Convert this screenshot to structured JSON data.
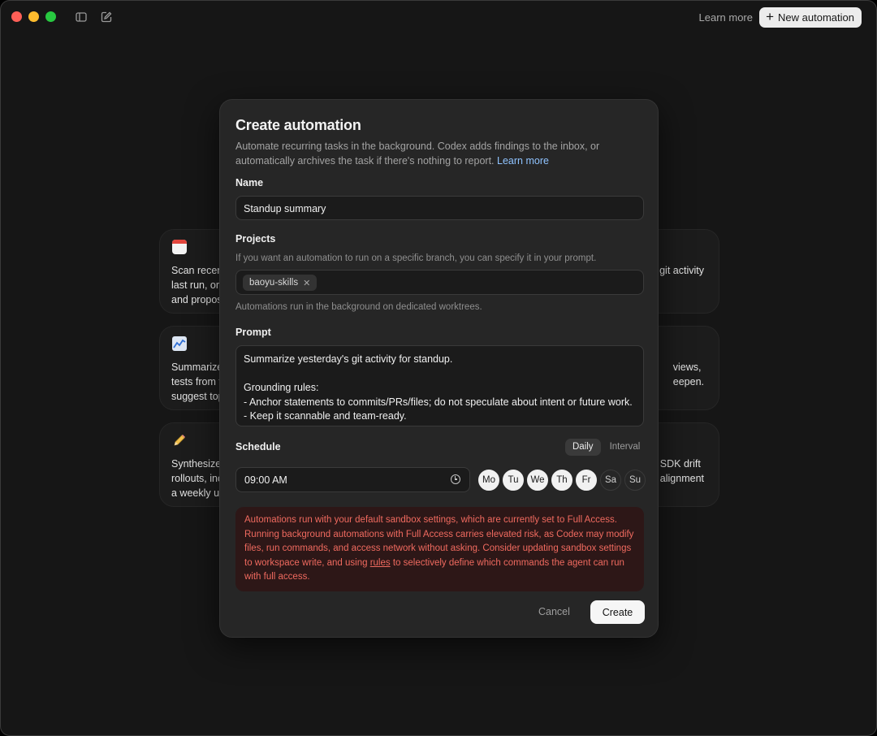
{
  "titlebar": {
    "learn_more": "Learn more",
    "new_automation": "New automation"
  },
  "bg_cards": [
    {
      "icon": "calendar-icon",
      "left_lines": [
        "Scan recen",
        "last run, or",
        "and propos"
      ],
      "right_lines": [
        "git activity"
      ]
    },
    {
      "icon": "chart-icon",
      "left_lines": [
        "Summarize",
        "tests from t",
        "suggest top"
      ],
      "right_lines": [
        "views,",
        "eepen."
      ]
    },
    {
      "icon": "pencil-icon",
      "left_lines": [
        "Synthesize",
        "rollouts, inc",
        "a weekly up"
      ],
      "right_lines": [
        "SDK drift",
        "alignment"
      ]
    }
  ],
  "modal": {
    "title": "Create automation",
    "description": "Automate recurring tasks in the background. Codex adds findings to the inbox, or automatically archives the task if there's nothing to report.",
    "description_link": "Learn more",
    "name_label": "Name",
    "name_value": "Standup summary",
    "projects_label": "Projects",
    "projects_hint": "If you want an automation to run on a specific branch, you can specify it in your prompt.",
    "project_chip": "baoyu-skills",
    "projects_note": "Automations run in the background on dedicated worktrees.",
    "prompt_label": "Prompt",
    "prompt_value": "Summarize yesterday's git activity for standup.\n\nGrounding rules:\n- Anchor statements to commits/PRs/files; do not speculate about intent or future work.\n- Keep it scannable and team-ready.",
    "schedule_label": "Schedule",
    "schedule_modes": [
      "Daily",
      "Interval"
    ],
    "schedule_active": "Daily",
    "time_value": "09:00 AM",
    "days": [
      {
        "label": "Mo",
        "selected": true
      },
      {
        "label": "Tu",
        "selected": true
      },
      {
        "label": "We",
        "selected": true
      },
      {
        "label": "Th",
        "selected": true
      },
      {
        "label": "Fr",
        "selected": true
      },
      {
        "label": "Sa",
        "selected": false
      },
      {
        "label": "Su",
        "selected": false
      }
    ],
    "warning_before": "Automations run with your default sandbox settings, which are currently set to Full Access. Running background automations with Full Access carries elevated risk, as Codex may modify files, run commands, and access network without asking. Consider updating sandbox settings to workspace write, and using",
    "warning_link": "rules",
    "warning_after": "to selectively define which commands the agent can run with full access.",
    "cancel": "Cancel",
    "create": "Create"
  },
  "colors": {
    "background": "#161616",
    "modal": "#262626",
    "link": "#8fc3ff",
    "warning_text": "#f06a5f",
    "warning_bg": "#2d1717"
  }
}
